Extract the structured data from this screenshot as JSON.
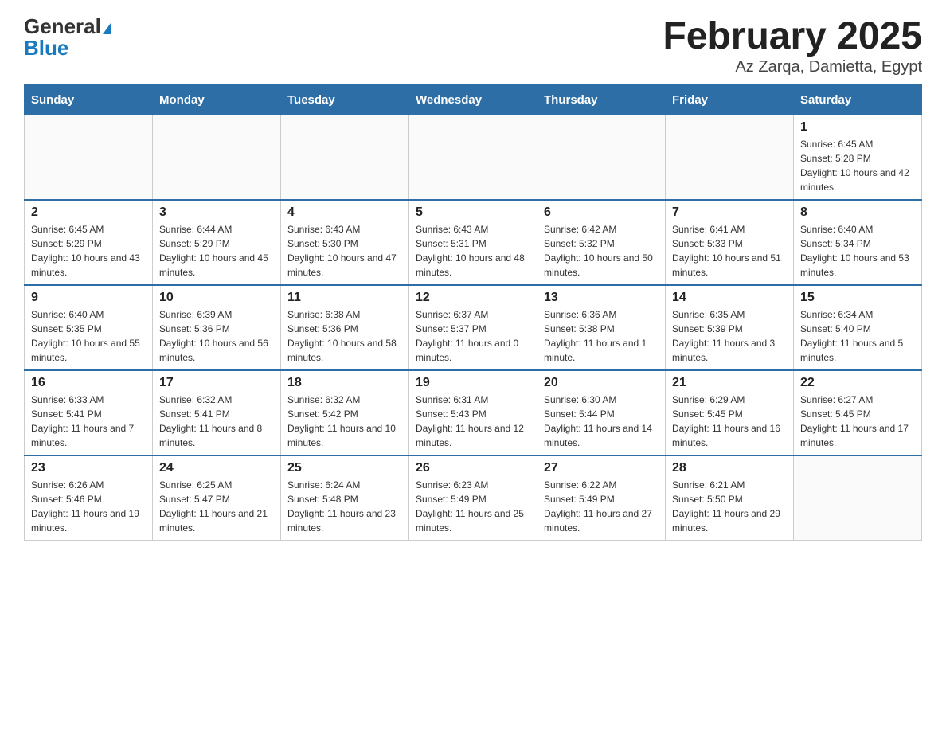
{
  "header": {
    "logo_general": "General",
    "logo_blue": "Blue",
    "month_title": "February 2025",
    "location": "Az Zarqa, Damietta, Egypt"
  },
  "days_of_week": [
    "Sunday",
    "Monday",
    "Tuesday",
    "Wednesday",
    "Thursday",
    "Friday",
    "Saturday"
  ],
  "weeks": [
    [
      {
        "day": "",
        "sunrise": "",
        "sunset": "",
        "daylight": ""
      },
      {
        "day": "",
        "sunrise": "",
        "sunset": "",
        "daylight": ""
      },
      {
        "day": "",
        "sunrise": "",
        "sunset": "",
        "daylight": ""
      },
      {
        "day": "",
        "sunrise": "",
        "sunset": "",
        "daylight": ""
      },
      {
        "day": "",
        "sunrise": "",
        "sunset": "",
        "daylight": ""
      },
      {
        "day": "",
        "sunrise": "",
        "sunset": "",
        "daylight": ""
      },
      {
        "day": "1",
        "sunrise": "Sunrise: 6:45 AM",
        "sunset": "Sunset: 5:28 PM",
        "daylight": "Daylight: 10 hours and 42 minutes."
      }
    ],
    [
      {
        "day": "2",
        "sunrise": "Sunrise: 6:45 AM",
        "sunset": "Sunset: 5:29 PM",
        "daylight": "Daylight: 10 hours and 43 minutes."
      },
      {
        "day": "3",
        "sunrise": "Sunrise: 6:44 AM",
        "sunset": "Sunset: 5:29 PM",
        "daylight": "Daylight: 10 hours and 45 minutes."
      },
      {
        "day": "4",
        "sunrise": "Sunrise: 6:43 AM",
        "sunset": "Sunset: 5:30 PM",
        "daylight": "Daylight: 10 hours and 47 minutes."
      },
      {
        "day": "5",
        "sunrise": "Sunrise: 6:43 AM",
        "sunset": "Sunset: 5:31 PM",
        "daylight": "Daylight: 10 hours and 48 minutes."
      },
      {
        "day": "6",
        "sunrise": "Sunrise: 6:42 AM",
        "sunset": "Sunset: 5:32 PM",
        "daylight": "Daylight: 10 hours and 50 minutes."
      },
      {
        "day": "7",
        "sunrise": "Sunrise: 6:41 AM",
        "sunset": "Sunset: 5:33 PM",
        "daylight": "Daylight: 10 hours and 51 minutes."
      },
      {
        "day": "8",
        "sunrise": "Sunrise: 6:40 AM",
        "sunset": "Sunset: 5:34 PM",
        "daylight": "Daylight: 10 hours and 53 minutes."
      }
    ],
    [
      {
        "day": "9",
        "sunrise": "Sunrise: 6:40 AM",
        "sunset": "Sunset: 5:35 PM",
        "daylight": "Daylight: 10 hours and 55 minutes."
      },
      {
        "day": "10",
        "sunrise": "Sunrise: 6:39 AM",
        "sunset": "Sunset: 5:36 PM",
        "daylight": "Daylight: 10 hours and 56 minutes."
      },
      {
        "day": "11",
        "sunrise": "Sunrise: 6:38 AM",
        "sunset": "Sunset: 5:36 PM",
        "daylight": "Daylight: 10 hours and 58 minutes."
      },
      {
        "day": "12",
        "sunrise": "Sunrise: 6:37 AM",
        "sunset": "Sunset: 5:37 PM",
        "daylight": "Daylight: 11 hours and 0 minutes."
      },
      {
        "day": "13",
        "sunrise": "Sunrise: 6:36 AM",
        "sunset": "Sunset: 5:38 PM",
        "daylight": "Daylight: 11 hours and 1 minute."
      },
      {
        "day": "14",
        "sunrise": "Sunrise: 6:35 AM",
        "sunset": "Sunset: 5:39 PM",
        "daylight": "Daylight: 11 hours and 3 minutes."
      },
      {
        "day": "15",
        "sunrise": "Sunrise: 6:34 AM",
        "sunset": "Sunset: 5:40 PM",
        "daylight": "Daylight: 11 hours and 5 minutes."
      }
    ],
    [
      {
        "day": "16",
        "sunrise": "Sunrise: 6:33 AM",
        "sunset": "Sunset: 5:41 PM",
        "daylight": "Daylight: 11 hours and 7 minutes."
      },
      {
        "day": "17",
        "sunrise": "Sunrise: 6:32 AM",
        "sunset": "Sunset: 5:41 PM",
        "daylight": "Daylight: 11 hours and 8 minutes."
      },
      {
        "day": "18",
        "sunrise": "Sunrise: 6:32 AM",
        "sunset": "Sunset: 5:42 PM",
        "daylight": "Daylight: 11 hours and 10 minutes."
      },
      {
        "day": "19",
        "sunrise": "Sunrise: 6:31 AM",
        "sunset": "Sunset: 5:43 PM",
        "daylight": "Daylight: 11 hours and 12 minutes."
      },
      {
        "day": "20",
        "sunrise": "Sunrise: 6:30 AM",
        "sunset": "Sunset: 5:44 PM",
        "daylight": "Daylight: 11 hours and 14 minutes."
      },
      {
        "day": "21",
        "sunrise": "Sunrise: 6:29 AM",
        "sunset": "Sunset: 5:45 PM",
        "daylight": "Daylight: 11 hours and 16 minutes."
      },
      {
        "day": "22",
        "sunrise": "Sunrise: 6:27 AM",
        "sunset": "Sunset: 5:45 PM",
        "daylight": "Daylight: 11 hours and 17 minutes."
      }
    ],
    [
      {
        "day": "23",
        "sunrise": "Sunrise: 6:26 AM",
        "sunset": "Sunset: 5:46 PM",
        "daylight": "Daylight: 11 hours and 19 minutes."
      },
      {
        "day": "24",
        "sunrise": "Sunrise: 6:25 AM",
        "sunset": "Sunset: 5:47 PM",
        "daylight": "Daylight: 11 hours and 21 minutes."
      },
      {
        "day": "25",
        "sunrise": "Sunrise: 6:24 AM",
        "sunset": "Sunset: 5:48 PM",
        "daylight": "Daylight: 11 hours and 23 minutes."
      },
      {
        "day": "26",
        "sunrise": "Sunrise: 6:23 AM",
        "sunset": "Sunset: 5:49 PM",
        "daylight": "Daylight: 11 hours and 25 minutes."
      },
      {
        "day": "27",
        "sunrise": "Sunrise: 6:22 AM",
        "sunset": "Sunset: 5:49 PM",
        "daylight": "Daylight: 11 hours and 27 minutes."
      },
      {
        "day": "28",
        "sunrise": "Sunrise: 6:21 AM",
        "sunset": "Sunset: 5:50 PM",
        "daylight": "Daylight: 11 hours and 29 minutes."
      },
      {
        "day": "",
        "sunrise": "",
        "sunset": "",
        "daylight": ""
      }
    ]
  ]
}
